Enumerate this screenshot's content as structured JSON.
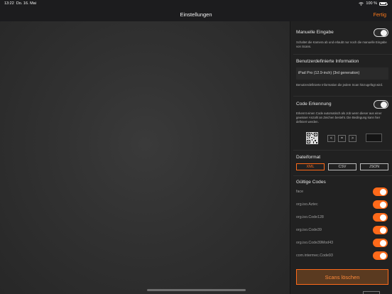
{
  "status_bar": {
    "time": "13:22",
    "date": "Do. 16. Mai",
    "battery": "100 %"
  },
  "nav": {
    "title": "Einstellungen",
    "done_label": "Fertig"
  },
  "manual_input": {
    "label": "Manuelle Eingabe",
    "description": "Schaltet die Kamera ab und erlaubt nur noch die manuelle Eingabe von Scans.",
    "enabled": false
  },
  "custom_info": {
    "label": "Benutzerdefinierte Information",
    "value": "iPad Pro (12.9-inch) (3rd generation)",
    "description": "Benutzerdefinierte Information die jedem Scan hinzugefügt wird."
  },
  "code_detection": {
    "label": "Code Erkennung",
    "description": "Erkennt einen Code automatisch als Job wenn dieser aus einer gewisser Anzahl an Zeichen besteht. Die Bedingung kann hier definiert werden.",
    "enabled": false,
    "buttons": {
      "prev": "<",
      "equal": "=",
      "next": ">"
    }
  },
  "file_format": {
    "label": "Dateiformat",
    "options": [
      "XML",
      "CSV",
      "JSON"
    ],
    "selected": "XML"
  },
  "valid_codes": {
    "label": "Gültige Codes",
    "items": [
      {
        "name": "face",
        "enabled": true
      },
      {
        "name": "org.iso.Aztec",
        "enabled": true
      },
      {
        "name": "org.iso.Code128",
        "enabled": true
      },
      {
        "name": "org.iso.Code39",
        "enabled": true
      },
      {
        "name": "org.iso.Code39Mod43",
        "enabled": true
      },
      {
        "name": "com.intermec.Code93",
        "enabled": true
      }
    ]
  },
  "clear_scans_label": "Scans löschen",
  "colors": {
    "accent": "#ff6a1a",
    "background": "#1c1c1e",
    "panel": "#212121"
  }
}
